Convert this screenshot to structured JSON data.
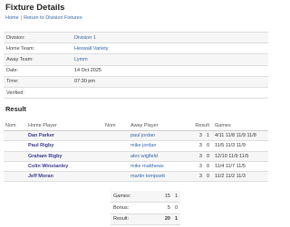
{
  "title": "Fixture Details",
  "breadcrumb": {
    "home": "Home",
    "separator": "|",
    "back": "Return to Division Fixtures"
  },
  "details": [
    {
      "label": "Division:",
      "value": "Division 1",
      "link": true
    },
    {
      "label": "Home Team:",
      "value": "Heswall Variety",
      "link": true
    },
    {
      "label": "Away Team:",
      "value": "Lymm",
      "link": true
    },
    {
      "label": "Date:",
      "value": "14 Oct 2025",
      "link": false
    },
    {
      "label": "Time:",
      "value": "07:30 pm",
      "link": false
    },
    {
      "label": "Verified:",
      "value": "",
      "link": false
    }
  ],
  "result_title": "Result",
  "result_headers": {
    "nom1": "Nom",
    "home": "Home Player",
    "nom2": "Nom",
    "away": "Away Player",
    "result": "Result",
    "games": "Games"
  },
  "results": [
    {
      "home": "Dan Parker",
      "away": "paul jordan",
      "home_score": "3",
      "away_score": "1",
      "games": "4/11 11/8 11/9 11/8"
    },
    {
      "home": "Paul Rigby",
      "away": "mike jordan",
      "home_score": "3",
      "away_score": "0",
      "games": "11/5 11/3 11/9"
    },
    {
      "home": "Graham Rigby",
      "away": "alex wigfield",
      "home_score": "3",
      "away_score": "0",
      "games": "12/10 11/9 11/5"
    },
    {
      "home": "Colin Winstanley",
      "away": "mike matthews",
      "home_score": "3",
      "away_score": "0",
      "games": "11/4 11/7 11/5"
    },
    {
      "home": "Jeff Moran",
      "away": "martin tompsett",
      "home_score": "3",
      "away_score": "0",
      "games": "11/2 11/2 11/3"
    }
  ],
  "summary": [
    {
      "label": "Games:",
      "home": "15",
      "away": "1",
      "bold": false
    },
    {
      "label": "Bonus:",
      "home": "5",
      "away": "0",
      "bold": false
    },
    {
      "label": "Result:",
      "home": "20",
      "away": "1",
      "bold": true
    }
  ]
}
